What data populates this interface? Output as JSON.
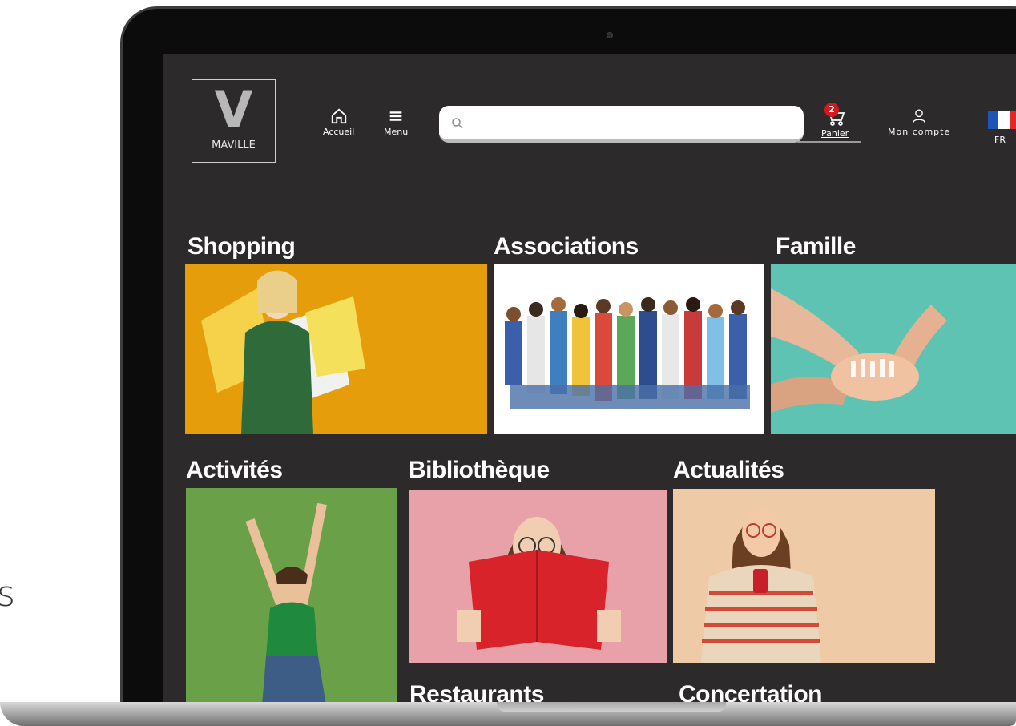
{
  "page_edge_text": "s",
  "header": {
    "logo_letter": "V",
    "logo_name": "MAVILLE",
    "home_label": "Accueil",
    "menu_label": "Menu",
    "search_placeholder": "",
    "cart_label": "Panier",
    "cart_count": "2",
    "account_label": "Mon compte",
    "language_label": "FR"
  },
  "categories": [
    {
      "title": "Shopping",
      "color": "#e59d0b"
    },
    {
      "title": "Associations",
      "color": "#ffffff"
    },
    {
      "title": "Famille",
      "color": "#5fc3b4"
    },
    {
      "title": "Activités",
      "color": "#6aa047"
    },
    {
      "title": "Bibliothèque",
      "color": "#e8a1a9"
    },
    {
      "title": "Actualités",
      "color": "#efcaa6"
    },
    {
      "title": "Restaurants",
      "color": ""
    },
    {
      "title": "Concertation",
      "color": ""
    }
  ],
  "colors": {
    "screen_bg": "#2c2a2a",
    "badge": "#d7191f"
  },
  "icons": [
    "home-icon",
    "menu-icon",
    "search-icon",
    "cart-icon",
    "user-icon",
    "french-flag-icon"
  ]
}
